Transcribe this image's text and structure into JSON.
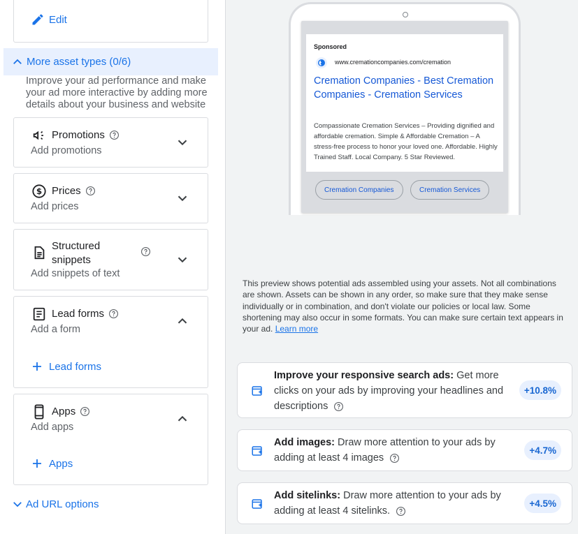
{
  "left_panel": {
    "edit_label": "Edit",
    "more_assets": {
      "title": "More asset types (0/6)",
      "description": "Improve your ad performance and make your ad more interactive by adding more details about your business and website"
    },
    "assets": [
      {
        "title": "Promotions",
        "subtitle": "Add promotions",
        "icon": "promotion-megaphone-icon",
        "expanded": false
      },
      {
        "title": "Prices",
        "subtitle": "Add prices",
        "icon": "price-dollar-icon",
        "expanded": false
      },
      {
        "title": "Structured snippets",
        "title_line1": "Structured",
        "title_line2": "snippets",
        "subtitle": "Add snippets of text",
        "icon": "document-icon",
        "expanded": false
      },
      {
        "title": "Lead forms",
        "subtitle": "Add a form",
        "icon": "form-icon",
        "expanded": true,
        "add_label": "Lead forms"
      },
      {
        "title": "Apps",
        "subtitle": "Add apps",
        "icon": "phone-icon",
        "expanded": true,
        "add_label": "Apps"
      }
    ],
    "url_options_label": "Ad URL options"
  },
  "preview": {
    "sponsored": "Sponsored",
    "display_url": "www.cremationcompanies.com/cremation",
    "headline": "Cremation Companies - Best Cremation Companies - Cremation Services",
    "description": "Compassionate Cremation Services – Providing dignified and affordable cremation. Simple & Affordable Cremation – A stress-free process to honor your loved one. Affordable. Highly Trained Staff. Local Company. 5 Star Reviewed.",
    "chips": [
      "Cremation Companies",
      "Cremation Services"
    ],
    "note": "This preview shows potential ads assembled using your assets. Not all combinations are shown. Assets can be shown in any order, so make sure that they make sense individually or in combination, and don't violate our policies or local law. Some shortening may also occur in some formats. You can make sure certain text appears in your ad.",
    "learn_more": "Learn more"
  },
  "recommendations": [
    {
      "title": "Improve your responsive search ads:",
      "body": "Get more clicks on your ads by improving your headlines and descriptions",
      "badge": "+10.8%"
    },
    {
      "title": "Add images:",
      "body": "Draw more attention to your ads by adding at least 4 images",
      "badge": "+4.7%"
    },
    {
      "title": "Add sitelinks:",
      "body": "Draw more attention to your ads by adding at least 4 sitelinks.",
      "badge": "+4.5%"
    }
  ],
  "colors": {
    "accent": "#1a73e8",
    "highlight": "#e8f0fe",
    "panel_bg": "#f1f3f4"
  }
}
